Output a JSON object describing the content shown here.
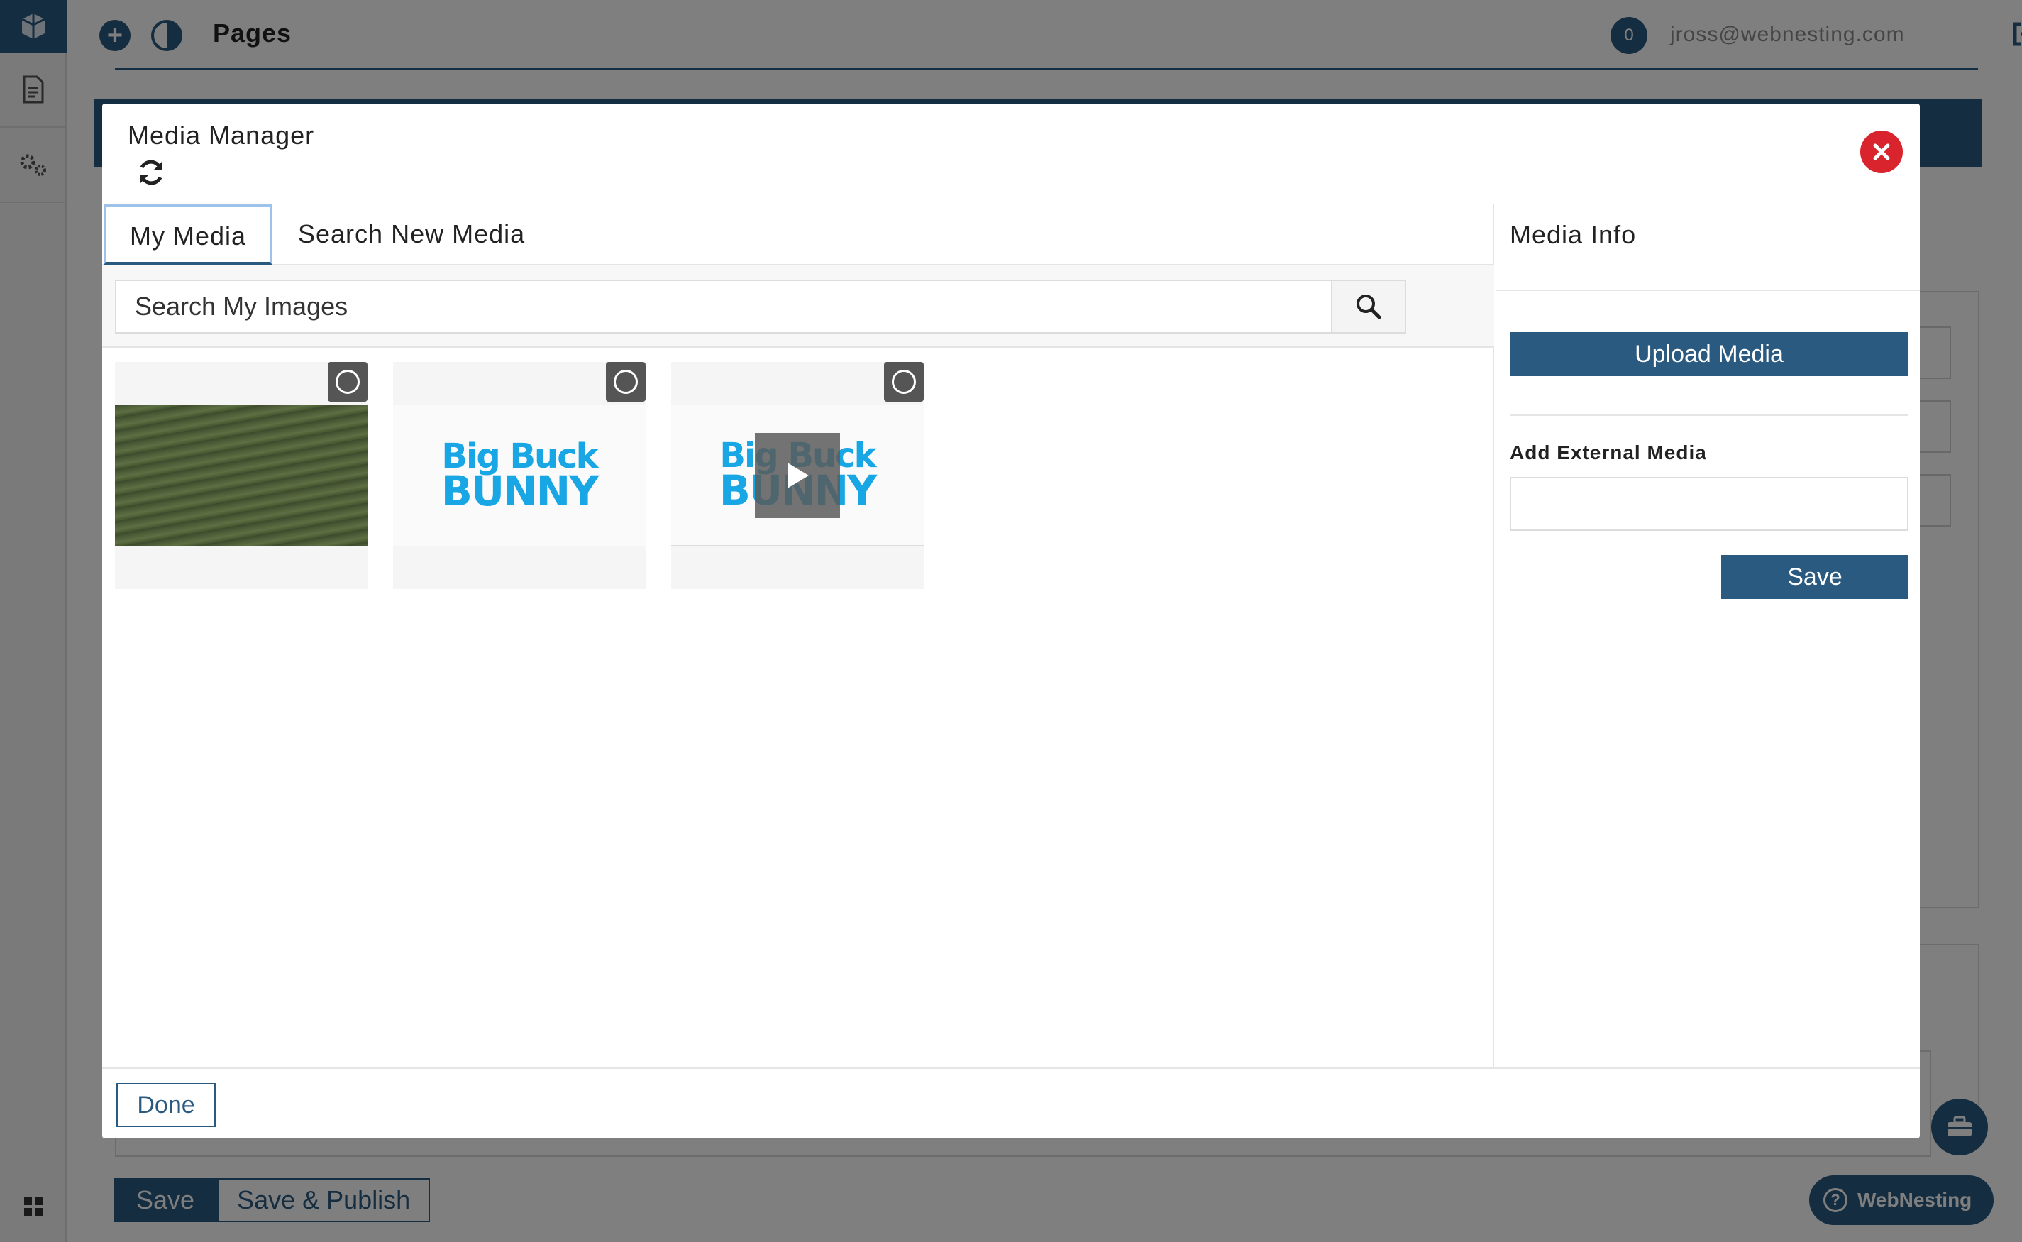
{
  "app": {
    "top_title": "Pages",
    "notification_count": "0",
    "user_email": "jross@webnesting.com",
    "bottom_save": "Save",
    "bottom_save_publish": "Save & Publish",
    "help_label": "WebNesting",
    "help_icon_glyph": "?",
    "plus_glyph": "+"
  },
  "modal": {
    "title": "Media Manager",
    "tabs": [
      {
        "label": "My Media",
        "active": true
      },
      {
        "label": "Search New Media",
        "active": false
      }
    ],
    "search": {
      "placeholder": "Search My Images",
      "value": ""
    },
    "media_items": [
      {
        "type": "image",
        "icon": "field-photo"
      },
      {
        "type": "image",
        "icon": "big-buck-bunny-logo",
        "logo_line1": "Big Buck",
        "logo_line2": "BUNNY"
      },
      {
        "type": "video",
        "icon": "big-buck-bunny-logo",
        "logo_line1": "Big Buck",
        "logo_line2": "BUNNY"
      }
    ],
    "info_panel": {
      "title": "Media Info",
      "upload_label": "Upload Media",
      "external_label": "Add External Media",
      "external_value": "",
      "save_label": "Save"
    },
    "done_label": "Done"
  },
  "colors": {
    "brand": "#2b5a80",
    "close": "#d9232d",
    "bunny": "#19a6e4"
  }
}
